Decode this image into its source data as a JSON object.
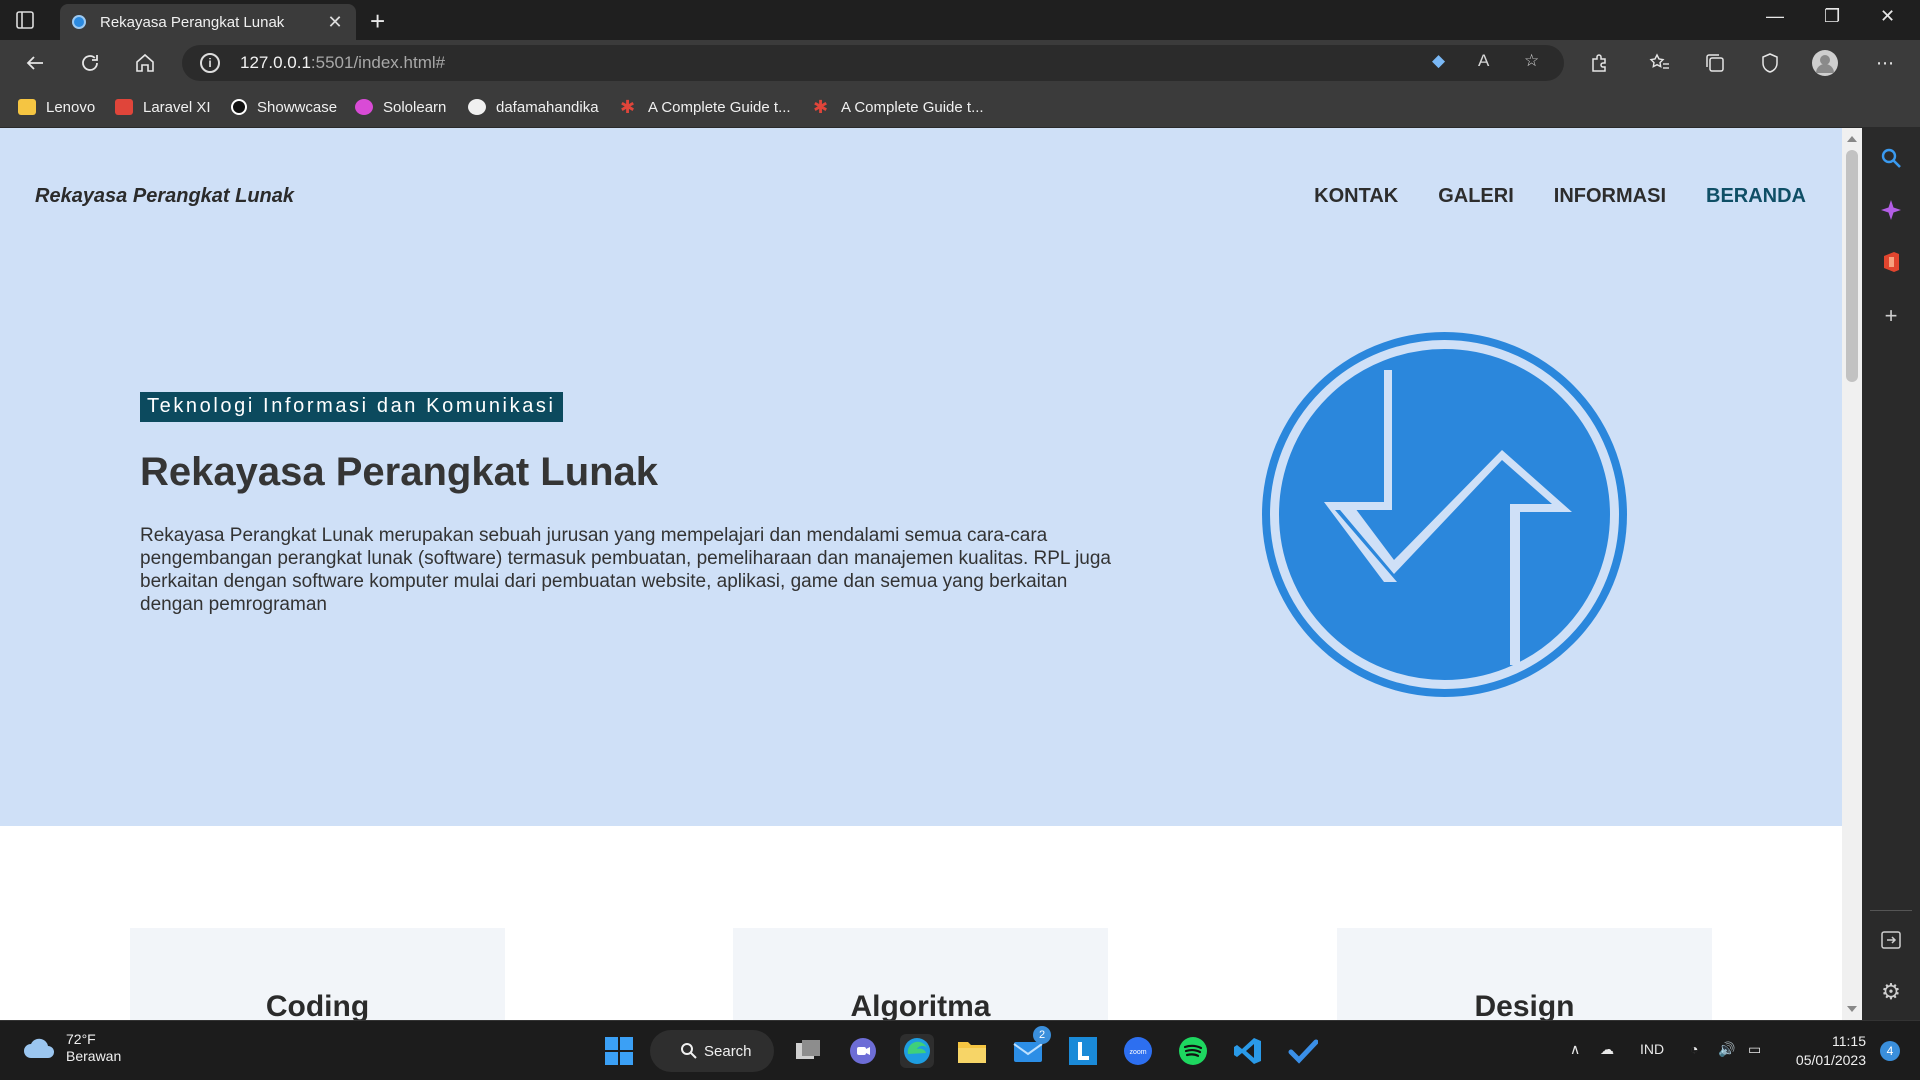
{
  "browser": {
    "tab_title": "Rekayasa Perangkat Lunak",
    "url_host": "127.0.0.1",
    "url_rest": ":5501/index.html#",
    "bookmarks": [
      "Lenovo",
      "Laravel XI",
      "Showwcase",
      "Sololearn",
      "dafamahandika",
      "A Complete Guide t...",
      "A Complete Guide t..."
    ]
  },
  "page": {
    "brand": "Rekayasa Perangkat Lunak",
    "nav": [
      "KONTAK",
      "GALERI",
      "INFORMASI",
      "BERANDA"
    ],
    "active_nav": "BERANDA",
    "kicker": "Teknologi Informasi dan Komunikasi",
    "title": "Rekayasa Perangkat Lunak",
    "description": "Rekayasa Perangkat Lunak merupakan sebuah jurusan yang mempelajari dan mendalami semua cara-cara pengembangan perangkat lunak (software) termasuk pembuatan, pemeliharaan dan manajemen kualitas. RPL juga berkaitan dengan software komputer mulai dari pembuatan website, aplikasi, game dan semua yang berkaitan dengan pemrograman",
    "cards": [
      "Coding",
      "Algoritma",
      "Design"
    ]
  },
  "taskbar": {
    "temperature": "72°F",
    "weather": "Berawan",
    "search_label": "Search",
    "mail_badge": "2",
    "language": "IND",
    "time": "11:15",
    "date": "05/01/2023",
    "notifications": "4"
  },
  "colors": {
    "hero_bg": "#cfe0f7",
    "kicker_bg": "#0c4a5e",
    "logo_blue": "#2b87dc",
    "active_nav": "#0f4f66"
  }
}
